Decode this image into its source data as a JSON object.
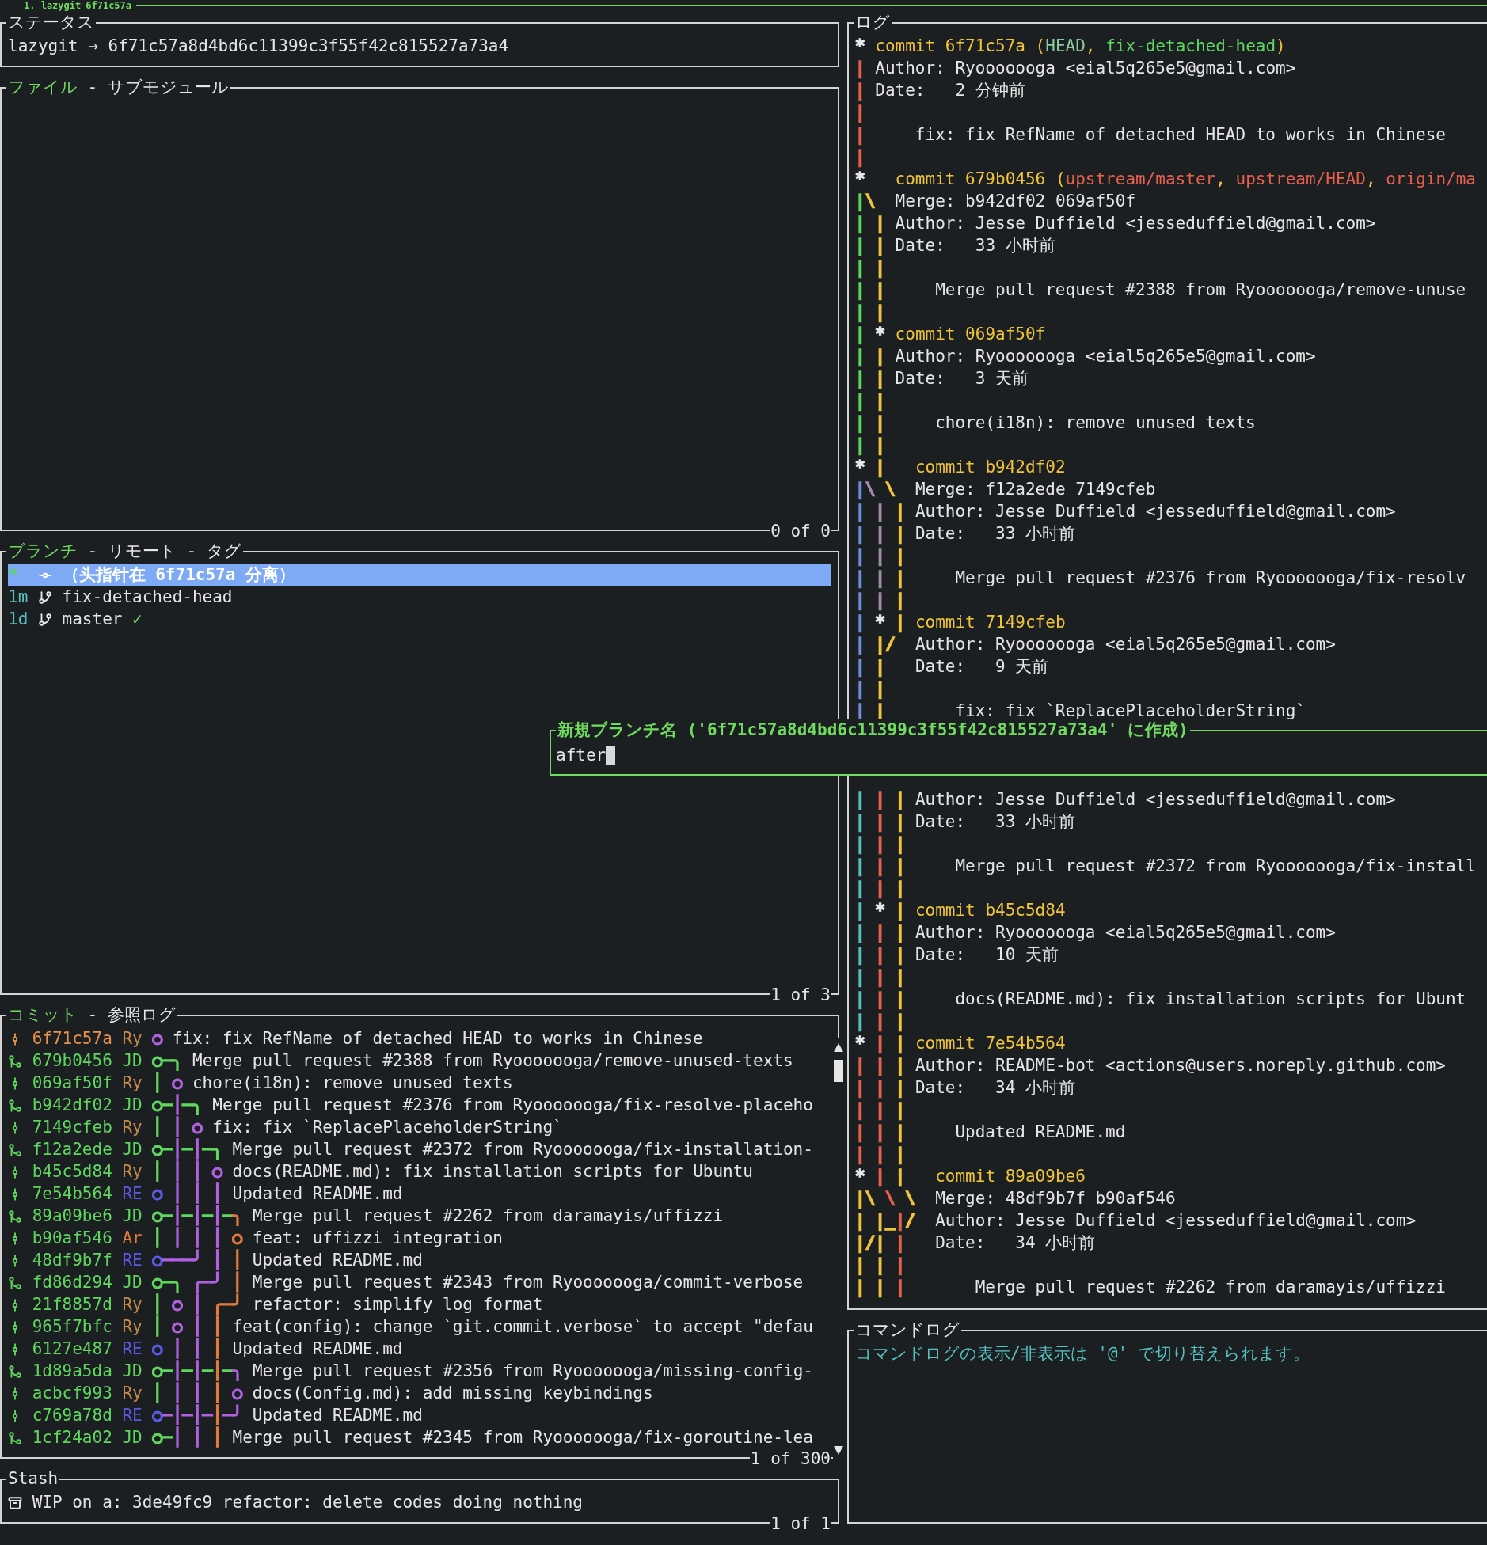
{
  "title_bar": {
    "label": "1. lazygit",
    "ref": "6f71c57a"
  },
  "status": {
    "title": "ステータス",
    "text": "lazygit → 6f71c57a8d4bd6c11399c3f55f42c815527a73a4"
  },
  "files": {
    "tabs": [
      {
        "label": "ファイル",
        "selected": true
      },
      {
        "label": "サブモジュール",
        "selected": false
      }
    ],
    "separators": [
      "-"
    ],
    "footer": "0 of 0"
  },
  "branches": {
    "tabs": [
      {
        "label": "ブランチ",
        "selected": true
      },
      {
        "label": "リモート",
        "selected": false
      },
      {
        "label": "タグ",
        "selected": false
      }
    ],
    "separators": [
      "-",
      "-"
    ],
    "footer": "1 of 3",
    "rows": [
      {
        "kind": "detached",
        "recency": "*",
        "name": "（头指针在 6f71c57a 分离）",
        "selected": true
      },
      {
        "kind": "branch",
        "recency": "1m",
        "name": "fix-detached-head",
        "selected": false
      },
      {
        "kind": "branch",
        "recency": "1d",
        "name": "master",
        "status": "✓",
        "selected": false
      }
    ]
  },
  "commits": {
    "tabs": [
      {
        "label": "コミット",
        "selected": true
      },
      {
        "label": "参照ログ",
        "selected": false
      }
    ],
    "separators": [
      "-"
    ],
    "footer": "1 of 300",
    "rows": [
      {
        "kind": "commit",
        "pushed": false,
        "hash": "6f71c57a",
        "author": "Ry",
        "color": "#c48a4c",
        "graph": [
          {
            "t": "○",
            "color": "#b060e0"
          }
        ],
        "message": "fix: fix RefName of detached HEAD to works in Chinese"
      },
      {
        "kind": "merge",
        "pushed": true,
        "hash": "679b0456",
        "author": "JD",
        "color": "#5fd75f",
        "graph": [
          {
            "t": "○",
            "color": "#5fd75f"
          },
          {
            "t": "─",
            "color": "#5fd75f"
          },
          {
            "t": "╮",
            "color": "#5fd75f"
          }
        ],
        "message": "Merge pull request #2388 from Ryooooooga/remove-unused-texts"
      },
      {
        "kind": "commit",
        "pushed": true,
        "hash": "069af50f",
        "author": "Ry",
        "color": "#c48a4c",
        "graph": [
          {
            "t": "│ ",
            "color": "#5fd75f"
          },
          {
            "t": "○",
            "color": "#b060e0"
          }
        ],
        "message": "chore(i18n): remove unused texts"
      },
      {
        "kind": "merge",
        "pushed": true,
        "hash": "b942df02",
        "author": "JD",
        "color": "#5fd75f",
        "graph": [
          {
            "t": "○",
            "color": "#5fd75f"
          },
          {
            "t": "─",
            "color": "#5fd75f"
          },
          {
            "t": "│",
            "color": "#b060e0"
          },
          {
            "t": "─",
            "color": "#5fd75f"
          },
          {
            "t": "╮",
            "color": "#5fd75f"
          }
        ],
        "message": "Merge pull request #2376 from Ryooooooga/fix-resolve-placeho"
      },
      {
        "kind": "commit",
        "pushed": true,
        "hash": "7149cfeb",
        "author": "Ry",
        "color": "#c48a4c",
        "graph": [
          {
            "t": "│ ",
            "color": "#5fd75f"
          },
          {
            "t": "│ ",
            "color": "#b060e0"
          },
          {
            "t": "○",
            "color": "#b060e0"
          }
        ],
        "message": "fix: fix `ReplacePlaceholderString`"
      },
      {
        "kind": "merge",
        "pushed": true,
        "hash": "f12a2ede",
        "author": "JD",
        "color": "#5fd75f",
        "graph": [
          {
            "t": "○",
            "color": "#5fd75f"
          },
          {
            "t": "─",
            "color": "#5fd75f"
          },
          {
            "t": "│",
            "color": "#b060e0"
          },
          {
            "t": "─",
            "color": "#5fd75f"
          },
          {
            "t": "│",
            "color": "#b060e0"
          },
          {
            "t": "─",
            "color": "#5fd75f"
          },
          {
            "t": "╮",
            "color": "#5fd75f"
          }
        ],
        "message": "Merge pull request #2372 from Ryooooooga/fix-installation-"
      },
      {
        "kind": "commit",
        "pushed": true,
        "hash": "b45c5d84",
        "author": "Ry",
        "color": "#c48a4c",
        "graph": [
          {
            "t": "│ ",
            "color": "#5fd75f"
          },
          {
            "t": "│ ",
            "color": "#b060e0"
          },
          {
            "t": "│ ",
            "color": "#b060e0"
          },
          {
            "t": "○",
            "color": "#b060e0"
          }
        ],
        "message": "docs(README.md): fix installation scripts for Ubuntu"
      },
      {
        "kind": "commit",
        "pushed": true,
        "hash": "7e54b564",
        "author": "RE",
        "color": "#5a5ae6",
        "graph": [
          {
            "t": "○ ",
            "color": "#5a5ae6"
          },
          {
            "t": "│ ",
            "color": "#b060e0"
          },
          {
            "t": "│ ",
            "color": "#b060e0"
          },
          {
            "t": "│",
            "color": "#b060e0"
          }
        ],
        "message": "Updated README.md"
      },
      {
        "kind": "merge",
        "pushed": true,
        "hash": "89a09be6",
        "author": "JD",
        "color": "#5fd75f",
        "graph": [
          {
            "t": "○",
            "color": "#5fd75f"
          },
          {
            "t": "─",
            "color": "#5fd75f"
          },
          {
            "t": "│",
            "color": "#b060e0"
          },
          {
            "t": "─",
            "color": "#5fd75f"
          },
          {
            "t": "│",
            "color": "#b060e0"
          },
          {
            "t": "─",
            "color": "#5fd75f"
          },
          {
            "t": "│",
            "color": "#b060e0"
          },
          {
            "t": "─",
            "color": "#5fd75f"
          },
          {
            "t": "╮",
            "color": "#e07a3c"
          }
        ],
        "message": "Merge pull request #2262 from daramayis/uffizzi"
      },
      {
        "kind": "commit",
        "pushed": true,
        "hash": "b90af546",
        "author": "Ar",
        "color": "#e07a3c",
        "graph": [
          {
            "t": "│ ",
            "color": "#5fd75f"
          },
          {
            "t": "│ ",
            "color": "#b060e0"
          },
          {
            "t": "│ ",
            "color": "#b060e0"
          },
          {
            "t": "│ ",
            "color": "#b060e0"
          },
          {
            "t": "○",
            "color": "#e07a3c"
          }
        ],
        "message": "feat: uffizzi integration"
      },
      {
        "kind": "commit",
        "pushed": true,
        "hash": "48df9b7f",
        "author": "RE",
        "color": "#5a5ae6",
        "graph": [
          {
            "t": "○",
            "color": "#5a5ae6"
          },
          {
            "t": "───╯ ",
            "color": "#b060e0"
          },
          {
            "t": "│ ",
            "color": "#b060e0"
          },
          {
            "t": "│",
            "color": "#e07a3c"
          }
        ],
        "message": "Updated README.md"
      },
      {
        "kind": "merge",
        "pushed": true,
        "hash": "fd86d294",
        "author": "JD",
        "color": "#5fd75f",
        "graph": [
          {
            "t": "○─╮ ",
            "color": "#5fd75f"
          },
          {
            "t": "╭─╯ ",
            "color": "#b060e0"
          },
          {
            "t": "│",
            "color": "#e07a3c"
          }
        ],
        "message": "Merge pull request #2343 from Ryooooooga/commit-verbose"
      },
      {
        "kind": "commit",
        "pushed": true,
        "hash": "21f8857d",
        "author": "Ry",
        "color": "#c48a4c",
        "graph": [
          {
            "t": "│ ",
            "color": "#5fd75f"
          },
          {
            "t": "○ ",
            "color": "#b060e0"
          },
          {
            "t": "│ ",
            "color": "#b060e0"
          },
          {
            "t": "╭─╯",
            "color": "#e07a3c"
          }
        ],
        "message": "refactor: simplify log format"
      },
      {
        "kind": "commit",
        "pushed": true,
        "hash": "965f7bfc",
        "author": "Ry",
        "color": "#c48a4c",
        "graph": [
          {
            "t": "│ ",
            "color": "#5fd75f"
          },
          {
            "t": "○ ",
            "color": "#b060e0"
          },
          {
            "t": "│ ",
            "color": "#b060e0"
          },
          {
            "t": "│",
            "color": "#e07a3c"
          }
        ],
        "message": "feat(config): change `git.commit.verbose` to accept \"defau"
      },
      {
        "kind": "commit",
        "pushed": true,
        "hash": "6127e487",
        "author": "RE",
        "color": "#5a5ae6",
        "graph": [
          {
            "t": "○ ",
            "color": "#5a5ae6"
          },
          {
            "t": "│ ",
            "color": "#b060e0"
          },
          {
            "t": "│ ",
            "color": "#b060e0"
          },
          {
            "t": "│",
            "color": "#e07a3c"
          }
        ],
        "message": "Updated README.md"
      },
      {
        "kind": "merge",
        "pushed": true,
        "hash": "1d89a5da",
        "author": "JD",
        "color": "#5fd75f",
        "graph": [
          {
            "t": "○",
            "color": "#5fd75f"
          },
          {
            "t": "─",
            "color": "#5fd75f"
          },
          {
            "t": "│",
            "color": "#b060e0"
          },
          {
            "t": "─",
            "color": "#5fd75f"
          },
          {
            "t": "│",
            "color": "#b060e0"
          },
          {
            "t": "─",
            "color": "#5fd75f"
          },
          {
            "t": "│",
            "color": "#e07a3c"
          },
          {
            "t": "─",
            "color": "#5fd75f"
          },
          {
            "t": "╮",
            "color": "#b060e0"
          }
        ],
        "message": "Merge pull request #2356 from Ryooooooga/missing-config-"
      },
      {
        "kind": "commit",
        "pushed": true,
        "hash": "acbcf993",
        "author": "Ry",
        "color": "#c48a4c",
        "graph": [
          {
            "t": "│ ",
            "color": "#5fd75f"
          },
          {
            "t": "│ ",
            "color": "#b060e0"
          },
          {
            "t": "│ ",
            "color": "#b060e0"
          },
          {
            "t": "│ ",
            "color": "#e07a3c"
          },
          {
            "t": "○",
            "color": "#b060e0"
          }
        ],
        "message": "docs(Config.md): add missing keybindings"
      },
      {
        "kind": "commit",
        "pushed": true,
        "hash": "c769a78d",
        "author": "RE",
        "color": "#5a5ae6",
        "graph": [
          {
            "t": "○",
            "color": "#5a5ae6"
          },
          {
            "t": "─│─│─",
            "color": "#b060e0"
          },
          {
            "t": "│",
            "color": "#e07a3c"
          },
          {
            "t": "─╯",
            "color": "#b060e0"
          }
        ],
        "message": "Updated README.md"
      },
      {
        "kind": "merge",
        "pushed": true,
        "hash": "1cf24a02",
        "author": "JD",
        "color": "#5fd75f",
        "graph": [
          {
            "t": "○─",
            "color": "#5fd75f"
          },
          {
            "t": "│ ",
            "color": "#b060e0"
          },
          {
            "t": "│ ",
            "color": "#b060e0"
          },
          {
            "t": "│",
            "color": "#e07a3c"
          }
        ],
        "message": "Merge pull request #2345 from Ryooooooga/fix-goroutine-lea"
      }
    ]
  },
  "stash": {
    "title": "Stash",
    "footer": "1 of 1",
    "rows": [
      {
        "text": "WIP on a: 3de49fc9 refactor: delete codes doing nothing"
      }
    ]
  },
  "log": {
    "title": "ログ",
    "segments": [
      {
        "lines": [
          {
            "graph": [
              {
                "t": "* ",
                "color": "#e6e6e6"
              }
            ],
            "kind": "commit",
            "text": "commit 6f71c57a",
            "refs": [
              {
                "t": "(",
                "color": "#f0c43a"
              },
              {
                "t": "HEAD",
                "color": "#8cc8a0"
              },
              {
                "t": ", ",
                "color": "#f0c43a"
              },
              {
                "t": "fix-detached-head",
                "color": "#5fd75f"
              },
              {
                "t": ")",
                "color": "#f0c43a"
              }
            ]
          },
          {
            "graph": [
              {
                "t": "| ",
                "color": "#e8604c"
              }
            ],
            "kind": "meta",
            "text": "Author: Ryooooooga <eial5q265e5@gmail.com>"
          },
          {
            "graph": [
              {
                "t": "| ",
                "color": "#e8604c"
              }
            ],
            "kind": "meta",
            "text": "Date:   2 分钟前"
          },
          {
            "graph": [
              {
                "t": "|",
                "color": "#e8604c"
              }
            ],
            "kind": "blank"
          },
          {
            "graph": [
              {
                "t": "| ",
                "color": "#e8604c"
              }
            ],
            "kind": "message",
            "text": "fix: fix RefName of detached HEAD to works in Chinese"
          },
          {
            "graph": [
              {
                "t": "|",
                "color": "#e8604c"
              }
            ],
            "kind": "blank"
          },
          {
            "graph": [
              {
                "t": "*   ",
                "color": "#e6e6e6"
              }
            ],
            "kind": "commit",
            "text": "commit 679b0456",
            "refs": [
              {
                "t": "(",
                "color": "#f0c43a"
              },
              {
                "t": "upstream/master",
                "color": "#e8604c"
              },
              {
                "t": ", ",
                "color": "#f0c43a"
              },
              {
                "t": "upstream/HEAD",
                "color": "#e8604c"
              },
              {
                "t": ", ",
                "color": "#f0c43a"
              },
              {
                "t": "origin/ma",
                "color": "#e8604c"
              }
            ]
          },
          {
            "graph": [
              {
                "t": "|",
                "color": "#5fd75f"
              },
              {
                "t": "\\  ",
                "color": "#f0c43a"
              }
            ],
            "kind": "meta",
            "text": "Merge: b942df02 069af50f"
          },
          {
            "graph": [
              {
                "t": "| ",
                "color": "#5fd75f"
              },
              {
                "t": "| ",
                "color": "#f0c43a"
              }
            ],
            "kind": "meta",
            "text": "Author: Jesse Duffield <jesseduffield@gmail.com>"
          },
          {
            "graph": [
              {
                "t": "| ",
                "color": "#5fd75f"
              },
              {
                "t": "| ",
                "color": "#f0c43a"
              }
            ],
            "kind": "meta",
            "text": "Date:   33 小时前"
          },
          {
            "graph": [
              {
                "t": "| ",
                "color": "#5fd75f"
              },
              {
                "t": "|",
                "color": "#f0c43a"
              }
            ],
            "kind": "blank"
          },
          {
            "graph": [
              {
                "t": "| ",
                "color": "#5fd75f"
              },
              {
                "t": "| ",
                "color": "#f0c43a"
              }
            ],
            "kind": "message",
            "text": "Merge pull request #2388 from Ryooooooga/remove-unuse"
          },
          {
            "graph": [
              {
                "t": "| ",
                "color": "#5fd75f"
              },
              {
                "t": "|",
                "color": "#f0c43a"
              }
            ],
            "kind": "blank"
          },
          {
            "graph": [
              {
                "t": "| ",
                "color": "#5fd75f"
              },
              {
                "t": "* ",
                "color": "#e6e6e6"
              }
            ],
            "kind": "commit",
            "text": "commit 069af50f"
          },
          {
            "graph": [
              {
                "t": "| ",
                "color": "#5fd75f"
              },
              {
                "t": "| ",
                "color": "#f0c43a"
              }
            ],
            "kind": "meta",
            "text": "Author: Ryooooooga <eial5q265e5@gmail.com>"
          },
          {
            "graph": [
              {
                "t": "| ",
                "color": "#5fd75f"
              },
              {
                "t": "| ",
                "color": "#f0c43a"
              }
            ],
            "kind": "meta",
            "text": "Date:   3 天前"
          },
          {
            "graph": [
              {
                "t": "| ",
                "color": "#5fd75f"
              },
              {
                "t": "|",
                "color": "#f0c43a"
              }
            ],
            "kind": "blank"
          },
          {
            "graph": [
              {
                "t": "| ",
                "color": "#5fd75f"
              },
              {
                "t": "| ",
                "color": "#f0c43a"
              }
            ],
            "kind": "message",
            "text": "chore(i18n): remove unused texts"
          },
          {
            "graph": [
              {
                "t": "| ",
                "color": "#5fd75f"
              },
              {
                "t": "|",
                "color": "#f0c43a"
              }
            ],
            "kind": "blank"
          },
          {
            "graph": [
              {
                "t": "* ",
                "color": "#e6e6e6"
              },
              {
                "t": "|   ",
                "color": "#f0c43a"
              }
            ],
            "kind": "commit",
            "text": "commit b942df02"
          },
          {
            "graph": [
              {
                "t": "|",
                "color": "#6f8fe0"
              },
              {
                "t": "\\ ",
                "color": "#a08aa8"
              },
              {
                "t": "\\  ",
                "color": "#f0c43a"
              }
            ],
            "kind": "meta",
            "text": "Merge: f12a2ede 7149cfeb"
          },
          {
            "graph": [
              {
                "t": "| ",
                "color": "#6f8fe0"
              },
              {
                "t": "| ",
                "color": "#a08aa8"
              },
              {
                "t": "| ",
                "color": "#f0c43a"
              }
            ],
            "kind": "meta",
            "text": "Author: Jesse Duffield <jesseduffield@gmail.com>"
          },
          {
            "graph": [
              {
                "t": "| ",
                "color": "#6f8fe0"
              },
              {
                "t": "| ",
                "color": "#a08aa8"
              },
              {
                "t": "| ",
                "color": "#f0c43a"
              }
            ],
            "kind": "meta",
            "text": "Date:   33 小时前"
          },
          {
            "graph": [
              {
                "t": "| ",
                "color": "#6f8fe0"
              },
              {
                "t": "| ",
                "color": "#a08aa8"
              },
              {
                "t": "|",
                "color": "#f0c43a"
              }
            ],
            "kind": "blank"
          },
          {
            "graph": [
              {
                "t": "| ",
                "color": "#6f8fe0"
              },
              {
                "t": "| ",
                "color": "#a08aa8"
              },
              {
                "t": "| ",
                "color": "#f0c43a"
              }
            ],
            "kind": "message",
            "text": "Merge pull request #2376 from Ryooooooga/fix-resolv"
          },
          {
            "graph": [
              {
                "t": "| ",
                "color": "#6f8fe0"
              },
              {
                "t": "| ",
                "color": "#a08aa8"
              },
              {
                "t": "|",
                "color": "#f0c43a"
              }
            ],
            "kind": "blank"
          },
          {
            "graph": [
              {
                "t": "| ",
                "color": "#6f8fe0"
              },
              {
                "t": "* ",
                "color": "#e6e6e6"
              },
              {
                "t": "| ",
                "color": "#f0c43a"
              }
            ],
            "kind": "commit",
            "text": "commit 7149cfeb"
          },
          {
            "graph": [
              {
                "t": "| ",
                "color": "#6f8fe0"
              },
              {
                "t": "|/  ",
                "color": "#f0c43a"
              }
            ],
            "kind": "meta",
            "text": "Author: Ryooooooga <eial5q265e5@gmail.com>"
          },
          {
            "graph": [
              {
                "t": "| ",
                "color": "#6f8fe0"
              },
              {
                "t": "|   ",
                "color": "#f0c43a"
              }
            ],
            "kind": "meta",
            "text": "Date:   9 天前"
          },
          {
            "graph": [
              {
                "t": "| ",
                "color": "#6f8fe0"
              },
              {
                "t": "|",
                "color": "#f0c43a"
              }
            ],
            "kind": "blank"
          },
          {
            "graph": [
              {
                "t": "| ",
                "color": "#6f8fe0"
              },
              {
                "t": "|   ",
                "color": "#f0c43a"
              }
            ],
            "kind": "message",
            "text": "fix: fix `ReplacePlaceholderString`"
          }
        ]
      },
      {
        "lines": [
          {
            "graph": [
              {
                "t": "| ",
                "color": "#56c2c0"
              },
              {
                "t": "| ",
                "color": "#e8604c"
              },
              {
                "t": "| ",
                "color": "#f0c43a"
              }
            ],
            "kind": "meta",
            "text": "Author: Jesse Duffield <jesseduffield@gmail.com>"
          },
          {
            "graph": [
              {
                "t": "| ",
                "color": "#56c2c0"
              },
              {
                "t": "| ",
                "color": "#e8604c"
              },
              {
                "t": "| ",
                "color": "#f0c43a"
              }
            ],
            "kind": "meta",
            "text": "Date:   33 小时前"
          },
          {
            "graph": [
              {
                "t": "| ",
                "color": "#56c2c0"
              },
              {
                "t": "| ",
                "color": "#e8604c"
              },
              {
                "t": "|",
                "color": "#f0c43a"
              }
            ],
            "kind": "blank"
          },
          {
            "graph": [
              {
                "t": "| ",
                "color": "#56c2c0"
              },
              {
                "t": "| ",
                "color": "#e8604c"
              },
              {
                "t": "| ",
                "color": "#f0c43a"
              }
            ],
            "kind": "message",
            "text": "Merge pull request #2372 from Ryooooooga/fix-install"
          },
          {
            "graph": [
              {
                "t": "| ",
                "color": "#56c2c0"
              },
              {
                "t": "| ",
                "color": "#e8604c"
              },
              {
                "t": "|",
                "color": "#f0c43a"
              }
            ],
            "kind": "blank"
          },
          {
            "graph": [
              {
                "t": "| ",
                "color": "#56c2c0"
              },
              {
                "t": "* ",
                "color": "#e6e6e6"
              },
              {
                "t": "| ",
                "color": "#f0c43a"
              }
            ],
            "kind": "commit",
            "text": "commit b45c5d84"
          },
          {
            "graph": [
              {
                "t": "| ",
                "color": "#56c2c0"
              },
              {
                "t": "| ",
                "color": "#e8604c"
              },
              {
                "t": "| ",
                "color": "#f0c43a"
              }
            ],
            "kind": "meta",
            "text": "Author: Ryooooooga <eial5q265e5@gmail.com>"
          },
          {
            "graph": [
              {
                "t": "| ",
                "color": "#56c2c0"
              },
              {
                "t": "| ",
                "color": "#e8604c"
              },
              {
                "t": "| ",
                "color": "#f0c43a"
              }
            ],
            "kind": "meta",
            "text": "Date:   10 天前"
          },
          {
            "graph": [
              {
                "t": "| ",
                "color": "#56c2c0"
              },
              {
                "t": "| ",
                "color": "#e8604c"
              },
              {
                "t": "|",
                "color": "#f0c43a"
              }
            ],
            "kind": "blank"
          },
          {
            "graph": [
              {
                "t": "| ",
                "color": "#56c2c0"
              },
              {
                "t": "| ",
                "color": "#e8604c"
              },
              {
                "t": "| ",
                "color": "#f0c43a"
              }
            ],
            "kind": "message",
            "text": "docs(README.md): fix installation scripts for Ubunt"
          },
          {
            "graph": [
              {
                "t": "| ",
                "color": "#56c2c0"
              },
              {
                "t": "| ",
                "color": "#e8604c"
              },
              {
                "t": "|",
                "color": "#f0c43a"
              }
            ],
            "kind": "blank"
          },
          {
            "graph": [
              {
                "t": "* ",
                "color": "#e6e6e6"
              },
              {
                "t": "| ",
                "color": "#e8604c"
              },
              {
                "t": "| ",
                "color": "#f0c43a"
              }
            ],
            "kind": "commit",
            "text": "commit 7e54b564"
          },
          {
            "graph": [
              {
                "t": "| | ",
                "color": "#e8604c"
              },
              {
                "t": "| ",
                "color": "#f0c43a"
              }
            ],
            "kind": "meta",
            "text": "Author: README-bot <actions@users.noreply.github.com>"
          },
          {
            "graph": [
              {
                "t": "| | ",
                "color": "#e8604c"
              },
              {
                "t": "| ",
                "color": "#f0c43a"
              }
            ],
            "kind": "meta",
            "text": "Date:   34 小时前"
          },
          {
            "graph": [
              {
                "t": "| | ",
                "color": "#e8604c"
              },
              {
                "t": "|",
                "color": "#f0c43a"
              }
            ],
            "kind": "blank"
          },
          {
            "graph": [
              {
                "t": "| | ",
                "color": "#e8604c"
              },
              {
                "t": "| ",
                "color": "#f0c43a"
              }
            ],
            "kind": "message",
            "text": "Updated README.md"
          },
          {
            "graph": [
              {
                "t": "| | ",
                "color": "#e8604c"
              },
              {
                "t": "|",
                "color": "#f0c43a"
              }
            ],
            "kind": "blank"
          },
          {
            "graph": [
              {
                "t": "* ",
                "color": "#e6e6e6"
              },
              {
                "t": "| ",
                "color": "#e8604c"
              },
              {
                "t": "|   ",
                "color": "#f0c43a"
              }
            ],
            "kind": "commit",
            "text": "commit 89a09be6"
          },
          {
            "graph": [
              {
                "t": "|\\ ",
                "color": "#f0c43a"
              },
              {
                "t": "\\ ",
                "color": "#e8604c"
              },
              {
                "t": "\\  ",
                "color": "#f0c43a"
              }
            ],
            "kind": "meta",
            "text": "Merge: 48df9b7f b90af546"
          },
          {
            "graph": [
              {
                "t": "| |_",
                "color": "#f0c43a"
              },
              {
                "t": "|",
                "color": "#e8604c"
              },
              {
                "t": "/  ",
                "color": "#f0c43a"
              }
            ],
            "kind": "meta",
            "text": "Author: Jesse Duffield <jesseduffield@gmail.com>"
          },
          {
            "graph": [
              {
                "t": "|/| ",
                "color": "#f0c43a"
              },
              {
                "t": "|   ",
                "color": "#e8604c"
              }
            ],
            "kind": "meta",
            "text": "Date:   34 小时前"
          },
          {
            "graph": [
              {
                "t": "| | ",
                "color": "#f0c43a"
              },
              {
                "t": "|",
                "color": "#e8604c"
              }
            ],
            "kind": "blank"
          },
          {
            "graph": [
              {
                "t": "| | ",
                "color": "#f0c43a"
              },
              {
                "t": "|   ",
                "color": "#e8604c"
              }
            ],
            "kind": "message",
            "text": "Merge pull request #2262 from daramayis/uffizzi"
          }
        ]
      }
    ]
  },
  "command_log": {
    "title": "コマンドログ",
    "text": "コマンドログの表示/非表示は '@' で切り替えられます。"
  },
  "popup": {
    "title": "新規ブランチ名 ('6f71c57a8d4bd6c11399c3f55f42c815527a73a4' に作成)",
    "value": "after"
  }
}
